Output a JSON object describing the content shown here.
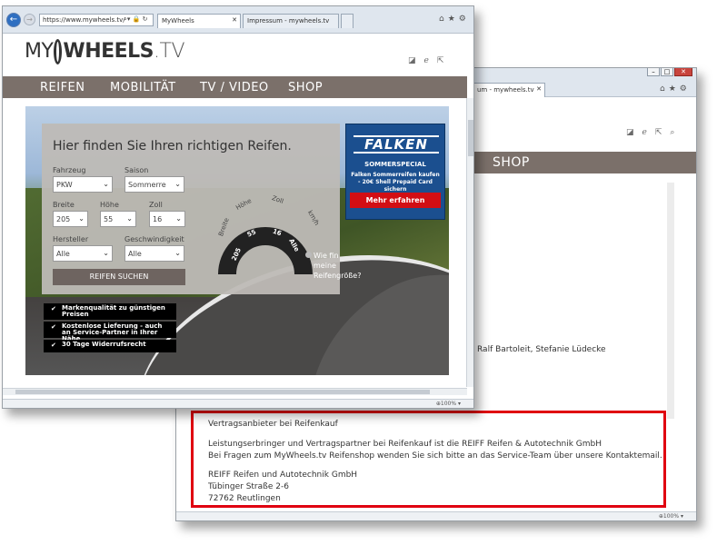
{
  "back_window": {
    "tab_label": "um - mywheels.tv",
    "shop_label": "SHOP",
    "names_text": "Ralf Bartoleit, Stefanie Lüdecke",
    "vertrag_title": "Vertragsanbieter bei Reifenkauf",
    "vertrag_line1": "Leistungserbringer und Vertragspartner bei Reifenkauf ist die REIFF Reifen & Autotechnik GmbH",
    "vertrag_line2": "Bei Fragen zum MyWheels.tv Reifenshop wenden Sie sich bitte an das Service-Team über unsere Kontaktemail.",
    "address_company": "REIFF Reifen und Autotechnik GmbH",
    "address_street": "Tübinger Straße 2-6",
    "address_city": "72762 Reutlingen",
    "zoom": "100%"
  },
  "front_window": {
    "url": "https://www.mywheels.tv/",
    "tab_active": "MyWheels",
    "tab_inactive": "Impressum - mywheels.tv",
    "zoom": "100%",
    "logo": {
      "my": "MY",
      "wheels": "WHEELS",
      "tv": ".TV"
    },
    "nav": [
      "REIFEN",
      "MOBILITÄT",
      "TV / VIDEO",
      "SHOP"
    ],
    "finder": {
      "heading": "Hier finden Sie Ihren richtigen Reifen.",
      "fahrzeug_label": "Fahrzeug",
      "fahrzeug_value": "PKW",
      "saison_label": "Saison",
      "saison_value": "Sommerre",
      "breite_label": "Breite",
      "breite_value": "205",
      "hoehe_label": "Höhe",
      "hoehe_value": "55",
      "zoll_label": "Zoll",
      "zoll_value": "16",
      "hersteller_label": "Hersteller",
      "hersteller_value": "Alle",
      "geschw_label": "Geschwindigkeit",
      "geschw_value": "Alle",
      "button": "REIFEN SUCHEN",
      "gauge_labels": [
        "Breite",
        "Höhe",
        "Zoll",
        "km/h"
      ],
      "gauge_values": [
        "205",
        "55",
        "16",
        "Alle"
      ],
      "hint": [
        "Wie fin",
        "meine",
        "Reifengröße?"
      ]
    },
    "benefits": [
      "Markenqualität zu günstigen Preisen",
      "Kostenlose Lieferung - auch an Service-Partner in Ihrer Nähe",
      "30 Tage Widerrufsrecht"
    ],
    "ad": {
      "brand": "FALKEN",
      "special": "SOMMERSPECIAL",
      "text": "Falken Sommerreifen kaufen - 20€ Shell Prepaid Card sichern",
      "cta": "Mehr erfahren"
    }
  },
  "colors": {
    "nav_bg": "#7b706a",
    "highlight": "#e00010",
    "ad_bg": "#1b4f8f",
    "cta": "#d20e14"
  }
}
